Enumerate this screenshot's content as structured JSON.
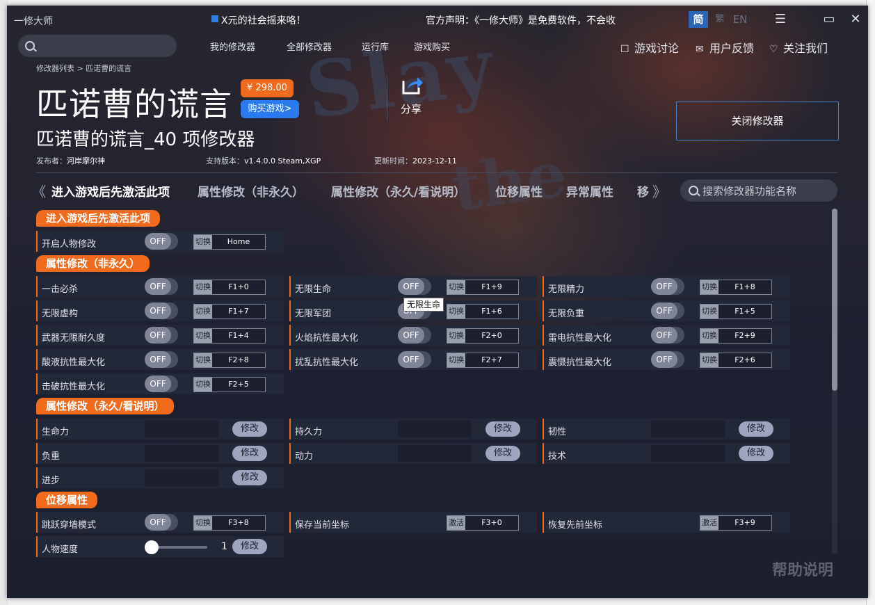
{
  "app": {
    "name": "一修大师",
    "ticker": "X元的社会摇来咯！",
    "notice": "官方声明：《一修大师》是免费软件，不会收"
  },
  "lang": {
    "zh": "简",
    "tw": "繁",
    "en": "EN"
  },
  "window_buttons": {
    "menu": "☰",
    "max": "▭",
    "close": "✕"
  },
  "nav": [
    "我的修改器",
    "全部修改器",
    "运行库",
    "游戏购买"
  ],
  "topright": [
    {
      "icon": "chat-icon",
      "glyph": "☐",
      "label": "游戏讨论"
    },
    {
      "icon": "mail-icon",
      "glyph": "✉",
      "label": "用户反馈"
    },
    {
      "icon": "heart-icon",
      "glyph": "♡",
      "label": "关注我们"
    }
  ],
  "breadcrumb": "修改器列表 > 匹诺曹的谎言",
  "game": {
    "title": "匹诺曹的谎言",
    "price": "¥ 298.00",
    "buy": "购买游戏>",
    "share": "分享",
    "close_trainer": "关闭修改器",
    "subtitle": "匹诺曹的谎言_40 项修改器"
  },
  "meta": {
    "publisher_label": "发布者：",
    "publisher": "河岸摩尔神",
    "version_label": "支持版本：",
    "version": "v1.4.0.0 Steam,XGP",
    "updated_label": "更新时间：",
    "updated": "2023-12-11"
  },
  "tabs": [
    "进入游戏后先激活此项",
    "属性修改（非永久）",
    "属性修改（永久/看说明）",
    "位移属性",
    "异常属性",
    "移"
  ],
  "chevrons": {
    "left": "《",
    "right": "》"
  },
  "feature_search": {
    "placeholder": "搜索修改器功能名称"
  },
  "common": {
    "off": "OFF",
    "switch_tag": "切换",
    "activate_tag": "激活",
    "modify": "修改"
  },
  "sections": [
    "进入游戏后先激活此项",
    "属性修改（非永久）",
    "属性修改（永久/看说明）",
    "位移属性"
  ],
  "toggles": [
    {
      "label": "开启人物修改",
      "key": "Home"
    },
    {
      "label": "一击必杀",
      "key": "F1+0"
    },
    {
      "label": "无限生命",
      "key": "F1+9"
    },
    {
      "label": "无限精力",
      "key": "F1+8"
    },
    {
      "label": "无限虚构",
      "key": "F1+7"
    },
    {
      "label": "无限军团",
      "key": "F1+6"
    },
    {
      "label": "无限负重",
      "key": "F1+5"
    },
    {
      "label": "武器无限耐久度",
      "key": "F1+4"
    },
    {
      "label": "火焰抗性最大化",
      "key": "F2+0"
    },
    {
      "label": "雷电抗性最大化",
      "key": "F2+9"
    },
    {
      "label": "酸液抗性最大化",
      "key": "F2+8"
    },
    {
      "label": "扰乱抗性最大化",
      "key": "F2+7"
    },
    {
      "label": "震慑抗性最大化",
      "key": "F2+6"
    },
    {
      "label": "击破抗性最大化",
      "key": "F2+5"
    }
  ],
  "inputs": [
    "生命力",
    "持久力",
    "韧性",
    "负重",
    "动力",
    "技术",
    "进步"
  ],
  "move": [
    {
      "label": "跳跃穿墙模式",
      "key": "F3+8"
    },
    {
      "label": "保存当前坐标",
      "key": "F3+0"
    },
    {
      "label": "恢复先前坐标",
      "key": "F3+9"
    }
  ],
  "slider": {
    "label": "人物速度",
    "value": "1",
    "level": 0
  },
  "tooltip": "无限生命",
  "help": "帮助说明"
}
